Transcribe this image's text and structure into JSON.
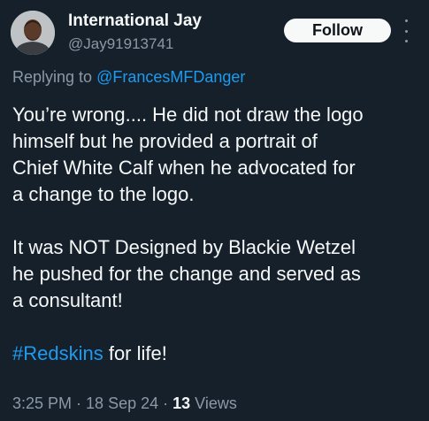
{
  "author": {
    "display_name": "International Jay",
    "handle": "@Jay91913741",
    "avatar_icon": "person-avatar"
  },
  "follow_label": "Follow",
  "reply": {
    "prefix": "Replying to",
    "mention": "@FrancesMFDanger"
  },
  "tweet": {
    "paragraph_1": "You’re wrong.... He did not draw the logo\nhimself but he provided a portrait of\nChief White Calf when he advocated for\na change to the logo.",
    "paragraph_2": "It was NOT Designed by Blackie Wetzel\nhe pushed for the change and served  as\na consultant!",
    "hashtag": "#Redskins",
    "hashtag_suffix": " for life!"
  },
  "meta": {
    "time": "3:25 PM",
    "date": "18 Sep 24",
    "views_count": "13",
    "views_label": "Views",
    "separator": " · "
  },
  "colors": {
    "background": "#15202b",
    "text": "#f7f9f9",
    "muted": "#8b98a5",
    "link": "#1d9bf0",
    "button_bg": "#f7f9f9"
  }
}
